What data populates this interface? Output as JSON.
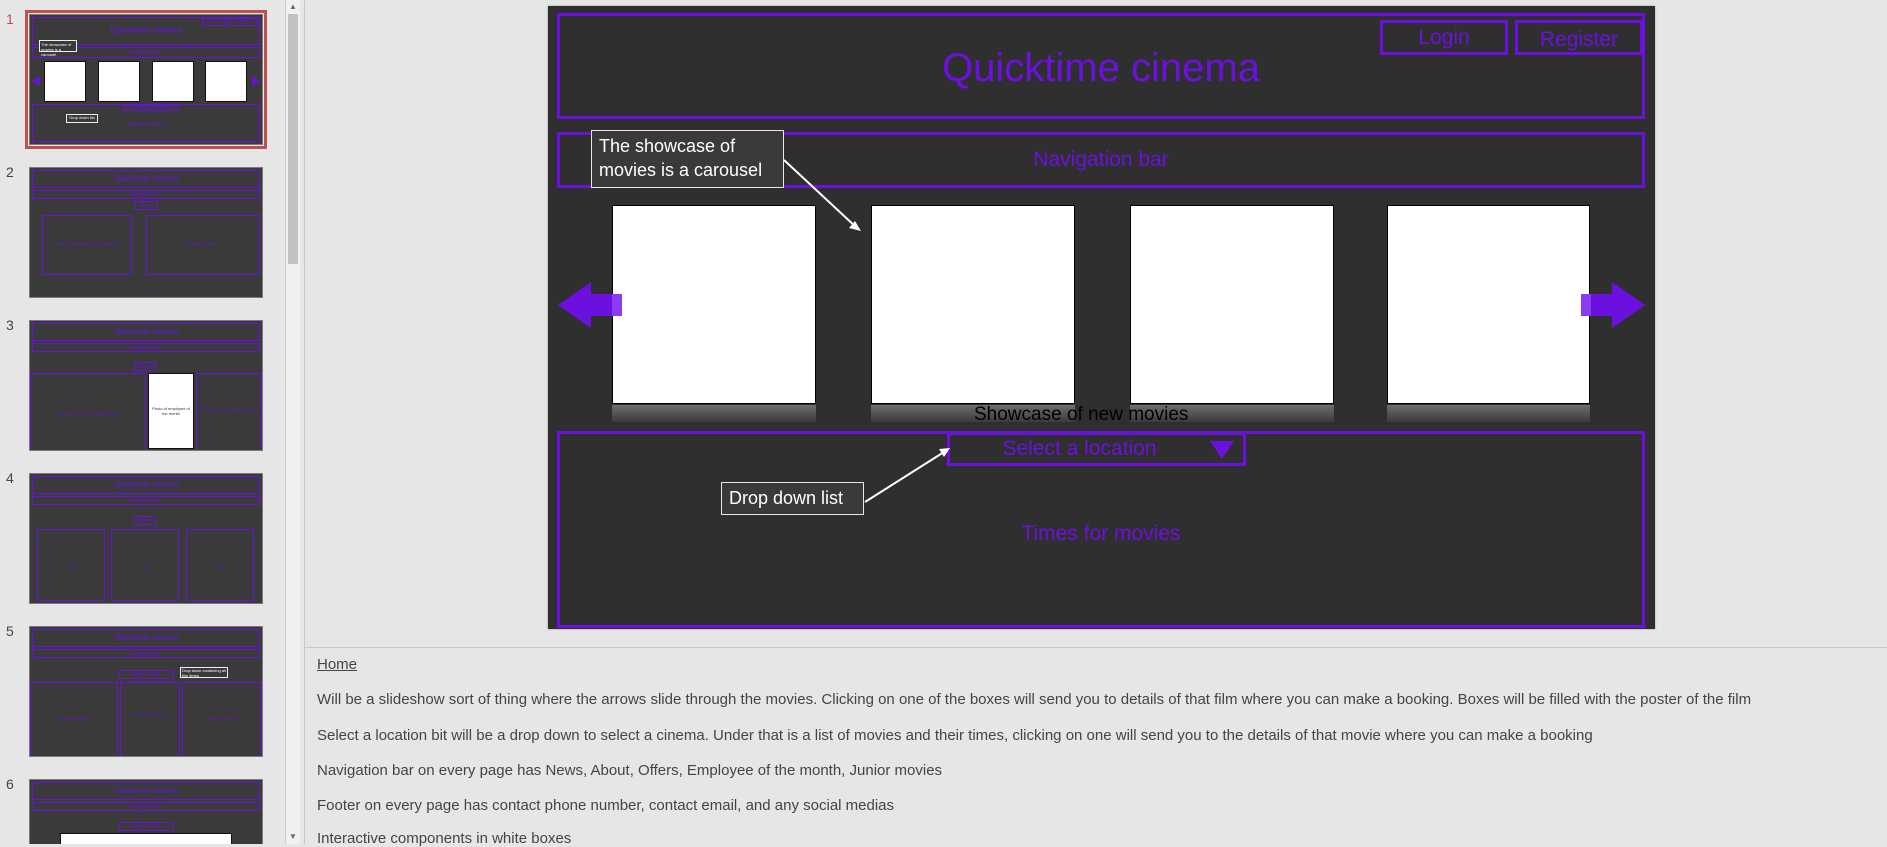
{
  "thumbnails": [
    {
      "number": "1",
      "title": "Quicktime cinema",
      "nav": "Navigation bar",
      "login": "Login",
      "register": "Register",
      "callout_carousel": "The showcase of movies is a carousel",
      "callout_dropdown": "Drop down list",
      "select": "Select a location",
      "times": "Times for movies"
    },
    {
      "number": "2",
      "title": "Quicktime cinema",
      "nav": "Navigation bar",
      "heading": "About",
      "left": "Place of information about cinema",
      "right": "Pictures of cinema"
    },
    {
      "number": "3",
      "title": "Quicktime cinema",
      "nav": "Navigation bar",
      "heading": "Offers",
      "left": "Descriptions of the available offers",
      "center": "Photo of employee of the month",
      "right": "Short description of the employee"
    },
    {
      "number": "4",
      "title": "Quicktime cinema",
      "nav": "Navigation bar",
      "heading": "Offers",
      "cells": [
        "Offer",
        "Offer",
        "Offer"
      ]
    },
    {
      "number": "5",
      "title": "Quicktime cinema",
      "nav": "Navigation bar",
      "heading": "Name of film",
      "callout": "Drop down containing all film times",
      "left": "Description of film",
      "center": "Poster of movie film",
      "right": "Times for the film"
    },
    {
      "number": "6",
      "title": "Quicktime cinema",
      "nav": "Navigation bar",
      "heading": "Name of film"
    }
  ],
  "slide": {
    "title": "Quicktime cinema",
    "login": "Login",
    "register": "Register",
    "nav": "Navigation bar",
    "showcase_label": "Showcase of new movies",
    "select_location": "Select a location",
    "times": "Times for movies",
    "callout_carousel": "The showcase of movies is a carousel",
    "callout_dropdown": "Drop down list",
    "accent_color": "#6c10e0"
  },
  "notes": {
    "heading": "Home",
    "lines": [
      "Will be a slideshow sort of thing where the arrows slide through the movies. Clicking on one of the boxes will send you to details of that film where you can make a booking. Boxes will be filled with the poster of the film",
      "Select a location bit will be a drop down to select a cinema. Under that is a list of movies and their times, clicking on one will send you to the details of that movie where you can make a booking",
      "Navigation bar on every page has News, About, Offers, Employee of the month, Junior movies",
      "Footer on every page has contact phone number, contact email, and any social medias",
      "Interactive components in white boxes"
    ]
  }
}
